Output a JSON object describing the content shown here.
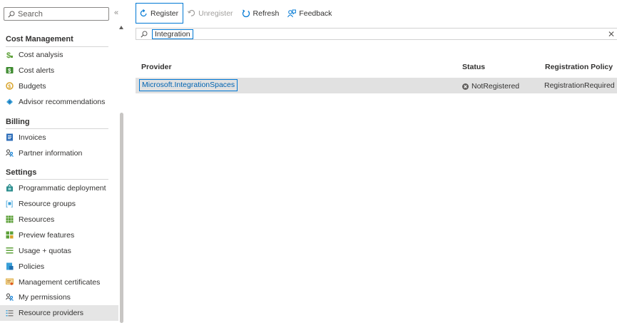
{
  "sidebar": {
    "search_placeholder": "Search",
    "collapse_glyph": "«",
    "sections": {
      "cost_management": {
        "title": "Cost Management",
        "items": [
          {
            "label": "Cost analysis",
            "icon": "cost-analysis-icon"
          },
          {
            "label": "Cost alerts",
            "icon": "cost-alerts-icon"
          },
          {
            "label": "Budgets",
            "icon": "budgets-icon"
          },
          {
            "label": "Advisor recommendations",
            "icon": "advisor-icon"
          }
        ]
      },
      "billing": {
        "title": "Billing",
        "items": [
          {
            "label": "Invoices",
            "icon": "invoices-icon"
          },
          {
            "label": "Partner information",
            "icon": "partner-icon"
          }
        ]
      },
      "settings": {
        "title": "Settings",
        "items": [
          {
            "label": "Programmatic deployment",
            "icon": "programmatic-deployment-icon"
          },
          {
            "label": "Resource groups",
            "icon": "resource-groups-icon"
          },
          {
            "label": "Resources",
            "icon": "resources-icon"
          },
          {
            "label": "Preview features",
            "icon": "preview-features-icon"
          },
          {
            "label": "Usage + quotas",
            "icon": "usage-quotas-icon"
          },
          {
            "label": "Policies",
            "icon": "policies-icon"
          },
          {
            "label": "Management certificates",
            "icon": "certificates-icon"
          },
          {
            "label": "My permissions",
            "icon": "permissions-icon"
          },
          {
            "label": "Resource providers",
            "icon": "resource-providers-icon",
            "active": true
          }
        ]
      }
    }
  },
  "toolbar": {
    "register": "Register",
    "unregister": "Unregister",
    "refresh": "Refresh",
    "feedback": "Feedback"
  },
  "filter": {
    "value": "Integration",
    "clear_glyph": "✕"
  },
  "table": {
    "columns": [
      "Provider",
      "Status",
      "Registration Policy"
    ],
    "rows": [
      {
        "provider": "Microsoft.IntegrationSpaces",
        "status": "NotRegistered",
        "policy": "RegistrationRequired"
      }
    ]
  },
  "colors": {
    "accent": "#0078d4",
    "link": "#0063b1",
    "row_selected": "#e1e1e1",
    "nav_active": "#e5e5e5"
  }
}
